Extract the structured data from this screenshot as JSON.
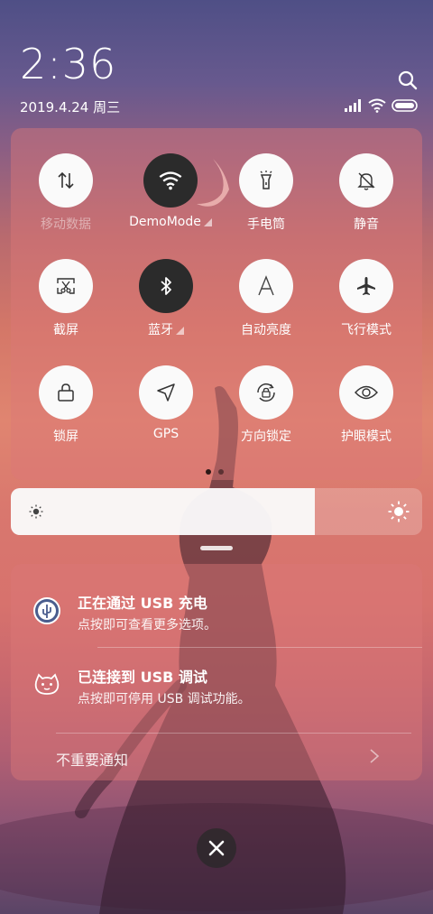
{
  "status": {
    "time": "2:36",
    "date": "2019.4.24 周三"
  },
  "icons": {
    "search": "search-icon",
    "signal": "signal-icon",
    "wifi": "wifi-icon",
    "battery": "battery-icon"
  },
  "tiles": [
    {
      "label": "移动数据",
      "icon": "mobile-data-icon",
      "active": false,
      "disabled": true
    },
    {
      "label": "DemoMode",
      "icon": "wifi-icon",
      "active": true,
      "expandable": true
    },
    {
      "label": "手电筒",
      "icon": "flashlight-icon",
      "active": false
    },
    {
      "label": "静音",
      "icon": "mute-bell-icon",
      "active": false
    },
    {
      "label": "截屏",
      "icon": "screenshot-icon",
      "active": false
    },
    {
      "label": "蓝牙",
      "icon": "bluetooth-icon",
      "active": true,
      "expandable": true
    },
    {
      "label": "自动亮度",
      "icon": "auto-brightness-icon",
      "active": false
    },
    {
      "label": "飞行模式",
      "icon": "airplane-icon",
      "active": false
    },
    {
      "label": "锁屏",
      "icon": "lock-icon",
      "active": false
    },
    {
      "label": "GPS",
      "icon": "gps-icon",
      "active": false
    },
    {
      "label": "方向锁定",
      "icon": "rotation-lock-icon",
      "active": false
    },
    {
      "label": "护眼模式",
      "icon": "eye-icon",
      "active": false
    }
  ],
  "brightness": {
    "level": 0.74
  },
  "notifications": [
    {
      "title": "正在通过 USB 充电",
      "text": "点按即可查看更多选项。",
      "icon": "usb-charge-icon"
    },
    {
      "title": "已连接到 USB 调试",
      "text": "点按即可停用 USB 调试功能。",
      "icon": "android-debug-icon"
    }
  ],
  "footer": {
    "unimportant_label": "不重要通知"
  }
}
